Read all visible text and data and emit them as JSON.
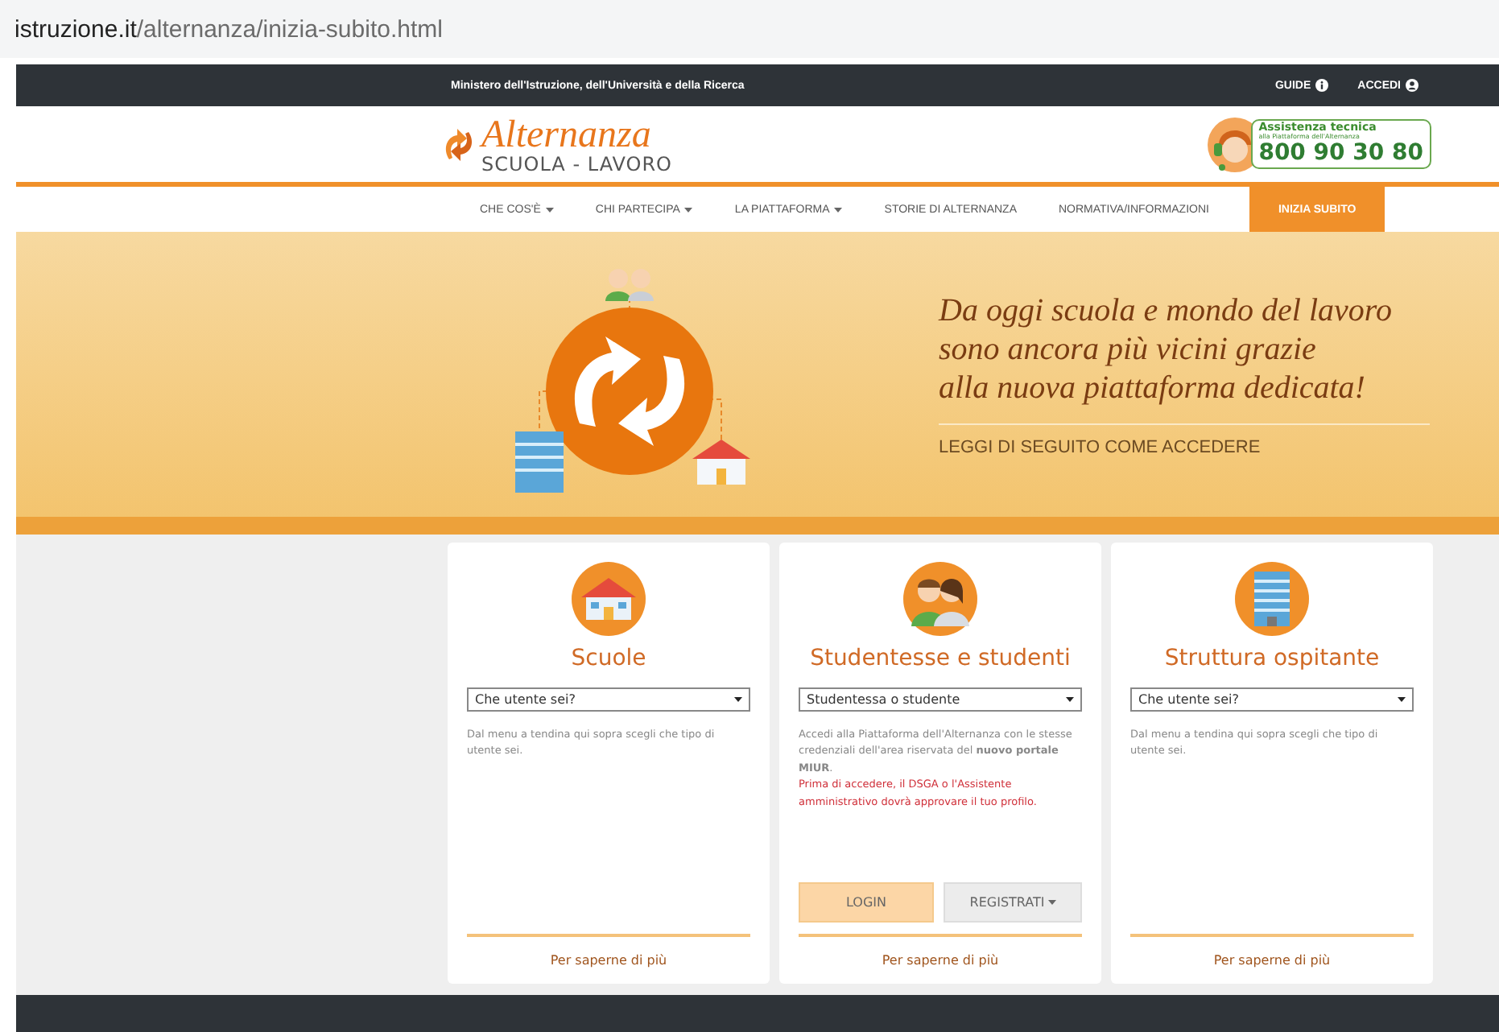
{
  "browser": {
    "url_host": "istruzione.it",
    "url_path": "/alternanza/inizia-subito.html"
  },
  "top_bar": {
    "ministry": "Ministero dell'Istruzione, dell'Università e della Ricerca",
    "links": [
      {
        "label": "GUIDE",
        "kind": "info"
      },
      {
        "label": "ACCEDI",
        "kind": "user"
      }
    ]
  },
  "header": {
    "logo_title": "Alternanza",
    "logo_subtitle": "SCUOLA - LAVORO",
    "help_title": "Assistenza tecnica",
    "help_subtitle": "alla Piattaforma dell'Alternanza",
    "help_phone": "800 90 30 80"
  },
  "nav": [
    {
      "label": "CHE COS'È",
      "dropdown": true,
      "selected": false
    },
    {
      "label": "CHI PARTECIPA",
      "dropdown": true,
      "selected": false
    },
    {
      "label": "LA PIATTAFORMA",
      "dropdown": true,
      "selected": false
    },
    {
      "label": "STORIE DI ALTERNANZA",
      "dropdown": false,
      "selected": false
    },
    {
      "label": "NORMATIVA/INFORMAZIONI",
      "dropdown": false,
      "selected": false
    },
    {
      "label": "INIZIA SUBITO",
      "dropdown": false,
      "selected": true
    }
  ],
  "hero": {
    "lines": [
      "Da oggi scuola e mondo del lavoro",
      "sono ancora più vicini grazie",
      "alla nuova piattaforma dedicata!"
    ],
    "cta": "LEGGI DI SEGUITO COME ACCEDERE"
  },
  "cards": [
    {
      "kind": "school",
      "title": "Scuole",
      "select": "Che utente sei?",
      "text": "Dal menu a tendina qui sopra scegli che tipo di utente sei.",
      "more": "Per saperne di più"
    },
    {
      "kind": "students",
      "title": "Studentesse e studenti",
      "select": "Studentessa o studente",
      "text": "Accedi alla Piattaforma dell'Alternanza con le stesse credenziali dell'area riservata del **nuovo portale MIUR**.",
      "warning": "Prima di accedere, il DSGA o l'Assistente amministrativo dovrà approvare il tuo profilo.",
      "buttons": [
        {
          "label": "LOGIN",
          "kind": "primary"
        },
        {
          "label": "REGISTRATI",
          "kind": "dropdown"
        }
      ],
      "more": "Per saperne di più"
    },
    {
      "kind": "building",
      "title": "Struttura ospitante",
      "select": "Che utente sei?",
      "text": "Dal menu a tendina qui sopra scegli che tipo di utente sei.",
      "more": "Per saperne di più"
    }
  ]
}
